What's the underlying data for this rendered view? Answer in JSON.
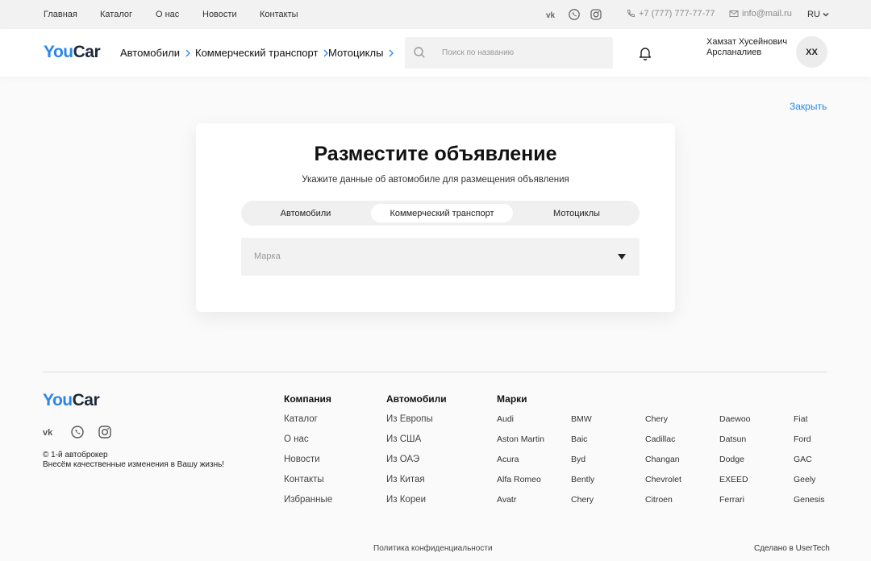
{
  "topbar": {
    "nav": [
      "Главная",
      "Каталог",
      "О нас",
      "Новости",
      "Контакты"
    ],
    "phone": "+7 (777) 777-77-77",
    "email": "info@mail.ru",
    "lang": "RU"
  },
  "header": {
    "logo": {
      "part1": "You",
      "part2": "Car"
    },
    "nav": [
      "Автомобили",
      "Коммерческий транспорт",
      "Мотоциклы"
    ],
    "search_placeholder": "Поиск по названию",
    "user_name_line1": "Хамзат Хусейнович",
    "user_name_line2": "Арсланалиев",
    "avatar_initials": "ХХ"
  },
  "close_label": "Закрыть",
  "card": {
    "title": "Разместите объявление",
    "subtitle": "Укажите данные об автомобиле для размещения объявления",
    "tabs": [
      "Автомобили",
      "Коммерческий транспорт",
      "Мотоциклы"
    ],
    "active_tab": "Коммерческий транспорт",
    "brand_placeholder": "Марка"
  },
  "footer": {
    "copyright_line1": "© 1-й автоброкер",
    "copyright_line2": "Внесём качественные изменения в Вашу жизнь!",
    "company_heading": "Компания",
    "company_links": [
      "Каталог",
      "О нас",
      "Новости",
      "Контакты",
      "Избранные"
    ],
    "cars_heading": "Автомобили",
    "cars_links": [
      "Из Европы",
      "Из США",
      "Из ОАЭ",
      "Из Китая",
      "Из Кореи"
    ],
    "brands_heading": "Марки",
    "brands_columns": [
      [
        "Audi",
        "Aston Martin",
        "Acura",
        "Alfa Romeo",
        "Avatr"
      ],
      [
        "BMW",
        "Baic",
        "Byd",
        "Bently",
        "Chery"
      ],
      [
        "Chery",
        "Cadillac",
        "Changan",
        "Chevrolet",
        "Citroen"
      ],
      [
        "Daewoo",
        "Datsun",
        "Dodge",
        "EXEED",
        "Ferrari"
      ],
      [
        "Fiat",
        "Ford",
        "GAC",
        "Geely",
        "Genesis"
      ]
    ],
    "policy": "Политика конфиденциальности",
    "made_by": "Сделано в UserTech"
  },
  "colors": {
    "accent": "#2a86e8",
    "logo_dark": "#1e2a3a"
  }
}
